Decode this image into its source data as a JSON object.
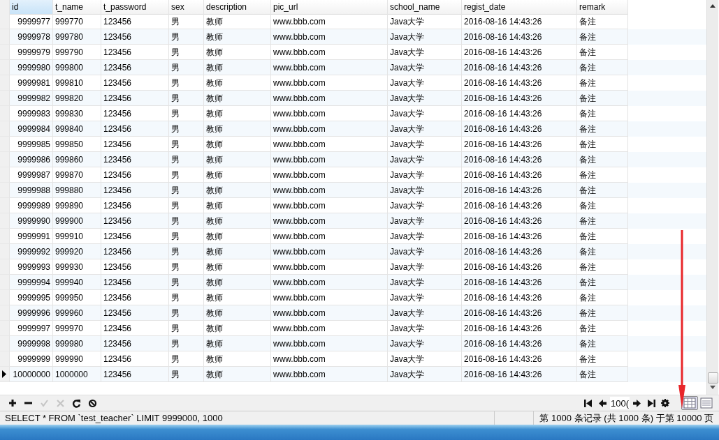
{
  "table": {
    "columns": [
      {
        "label": "id",
        "selected": true
      },
      {
        "label": "t_name",
        "selected": false
      },
      {
        "label": "t_password",
        "selected": false
      },
      {
        "label": "sex",
        "selected": false
      },
      {
        "label": "description",
        "selected": false
      },
      {
        "label": "pic_url",
        "selected": false
      },
      {
        "label": "school_name",
        "selected": false
      },
      {
        "label": "regist_date",
        "selected": false
      },
      {
        "label": "remark",
        "selected": false
      }
    ],
    "rows": [
      {
        "current": false,
        "cells": [
          "9999977",
          "999770",
          "123456",
          "男",
          "教师",
          "www.bbb.com",
          "Java大学",
          "2016-08-16 14:43:26",
          "备注"
        ]
      },
      {
        "current": false,
        "cells": [
          "9999978",
          "999780",
          "123456",
          "男",
          "教师",
          "www.bbb.com",
          "Java大学",
          "2016-08-16 14:43:26",
          "备注"
        ]
      },
      {
        "current": false,
        "cells": [
          "9999979",
          "999790",
          "123456",
          "男",
          "教师",
          "www.bbb.com",
          "Java大学",
          "2016-08-16 14:43:26",
          "备注"
        ]
      },
      {
        "current": false,
        "cells": [
          "9999980",
          "999800",
          "123456",
          "男",
          "教师",
          "www.bbb.com",
          "Java大学",
          "2016-08-16 14:43:26",
          "备注"
        ]
      },
      {
        "current": false,
        "cells": [
          "9999981",
          "999810",
          "123456",
          "男",
          "教师",
          "www.bbb.com",
          "Java大学",
          "2016-08-16 14:43:26",
          "备注"
        ]
      },
      {
        "current": false,
        "cells": [
          "9999982",
          "999820",
          "123456",
          "男",
          "教师",
          "www.bbb.com",
          "Java大学",
          "2016-08-16 14:43:26",
          "备注"
        ]
      },
      {
        "current": false,
        "cells": [
          "9999983",
          "999830",
          "123456",
          "男",
          "教师",
          "www.bbb.com",
          "Java大学",
          "2016-08-16 14:43:26",
          "备注"
        ]
      },
      {
        "current": false,
        "cells": [
          "9999984",
          "999840",
          "123456",
          "男",
          "教师",
          "www.bbb.com",
          "Java大学",
          "2016-08-16 14:43:26",
          "备注"
        ]
      },
      {
        "current": false,
        "cells": [
          "9999985",
          "999850",
          "123456",
          "男",
          "教师",
          "www.bbb.com",
          "Java大学",
          "2016-08-16 14:43:26",
          "备注"
        ]
      },
      {
        "current": false,
        "cells": [
          "9999986",
          "999860",
          "123456",
          "男",
          "教师",
          "www.bbb.com",
          "Java大学",
          "2016-08-16 14:43:26",
          "备注"
        ]
      },
      {
        "current": false,
        "cells": [
          "9999987",
          "999870",
          "123456",
          "男",
          "教师",
          "www.bbb.com",
          "Java大学",
          "2016-08-16 14:43:26",
          "备注"
        ]
      },
      {
        "current": false,
        "cells": [
          "9999988",
          "999880",
          "123456",
          "男",
          "教师",
          "www.bbb.com",
          "Java大学",
          "2016-08-16 14:43:26",
          "备注"
        ]
      },
      {
        "current": false,
        "cells": [
          "9999989",
          "999890",
          "123456",
          "男",
          "教师",
          "www.bbb.com",
          "Java大学",
          "2016-08-16 14:43:26",
          "备注"
        ]
      },
      {
        "current": false,
        "cells": [
          "9999990",
          "999900",
          "123456",
          "男",
          "教师",
          "www.bbb.com",
          "Java大学",
          "2016-08-16 14:43:26",
          "备注"
        ]
      },
      {
        "current": false,
        "cells": [
          "9999991",
          "999910",
          "123456",
          "男",
          "教师",
          "www.bbb.com",
          "Java大学",
          "2016-08-16 14:43:26",
          "备注"
        ]
      },
      {
        "current": false,
        "cells": [
          "9999992",
          "999920",
          "123456",
          "男",
          "教师",
          "www.bbb.com",
          "Java大学",
          "2016-08-16 14:43:26",
          "备注"
        ]
      },
      {
        "current": false,
        "cells": [
          "9999993",
          "999930",
          "123456",
          "男",
          "教师",
          "www.bbb.com",
          "Java大学",
          "2016-08-16 14:43:26",
          "备注"
        ]
      },
      {
        "current": false,
        "cells": [
          "9999994",
          "999940",
          "123456",
          "男",
          "教师",
          "www.bbb.com",
          "Java大学",
          "2016-08-16 14:43:26",
          "备注"
        ]
      },
      {
        "current": false,
        "cells": [
          "9999995",
          "999950",
          "123456",
          "男",
          "教师",
          "www.bbb.com",
          "Java大学",
          "2016-08-16 14:43:26",
          "备注"
        ]
      },
      {
        "current": false,
        "cells": [
          "9999996",
          "999960",
          "123456",
          "男",
          "教师",
          "www.bbb.com",
          "Java大学",
          "2016-08-16 14:43:26",
          "备注"
        ]
      },
      {
        "current": false,
        "cells": [
          "9999997",
          "999970",
          "123456",
          "男",
          "教师",
          "www.bbb.com",
          "Java大学",
          "2016-08-16 14:43:26",
          "备注"
        ]
      },
      {
        "current": false,
        "cells": [
          "9999998",
          "999980",
          "123456",
          "男",
          "教师",
          "www.bbb.com",
          "Java大学",
          "2016-08-16 14:43:26",
          "备注"
        ]
      },
      {
        "current": false,
        "cells": [
          "9999999",
          "999990",
          "123456",
          "男",
          "教师",
          "www.bbb.com",
          "Java大学",
          "2016-08-16 14:43:26",
          "备注"
        ]
      },
      {
        "current": true,
        "cells": [
          "10000000",
          "1000000",
          "123456",
          "男",
          "教师",
          "www.bbb.com",
          "Java大学",
          "2016-08-16 14:43:26",
          "备注"
        ]
      }
    ]
  },
  "toolbar": {
    "edit_buttons": [
      {
        "kind": "add",
        "disabled": false
      },
      {
        "kind": "remove",
        "disabled": false
      },
      {
        "kind": "apply",
        "disabled": true
      },
      {
        "kind": "cancel",
        "disabled": true
      },
      {
        "kind": "refresh",
        "disabled": false
      },
      {
        "kind": "stop",
        "disabled": false
      }
    ],
    "page_field": {
      "value": "100("
    },
    "views": [
      {
        "kind": "grid",
        "selected": true
      },
      {
        "kind": "form",
        "selected": false
      }
    ]
  },
  "status_bar": {
    "query": "SELECT * FROM `test_teacher` LIMIT 9999000, 1000",
    "record_info": "第 1000 条记录 (共 1000 条) 于第 10000 页"
  }
}
